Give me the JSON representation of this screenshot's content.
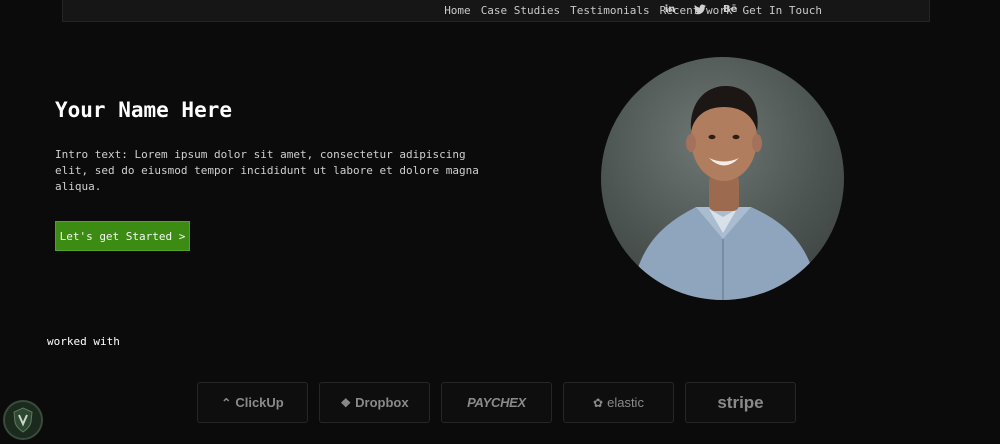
{
  "nav": {
    "links": [
      "Home",
      "Case Studies",
      "Testimonials",
      "Recent work",
      "Get In Touch"
    ],
    "social": [
      {
        "icon": "linkedin-icon",
        "glyph": "in"
      },
      {
        "icon": "twitter-icon",
        "glyph": ""
      },
      {
        "icon": "behance-icon",
        "glyph": "Bē"
      }
    ]
  },
  "hero": {
    "title": "Your Name Here",
    "intro": "Intro text: Lorem ipsum dolor sit amet, consectetur adipiscing elit, sed do eiusmod tempor incididunt ut labore et dolore magna aliqua.",
    "cta_label": "Let's get Started >"
  },
  "clients": {
    "label": "worked with",
    "logos": [
      {
        "name": "ClickUp",
        "glyph": "⌃"
      },
      {
        "name": "Dropbox",
        "glyph": "❖"
      },
      {
        "name": "PAYCHEX",
        "glyph": ""
      },
      {
        "name": "elastic",
        "glyph": "✿"
      },
      {
        "name": "stripe",
        "glyph": ""
      }
    ]
  },
  "colors": {
    "background": "#0b0b0b",
    "navbar": "#161616",
    "accent": "#3c8b12",
    "logo_text": "#8a8a8a"
  }
}
